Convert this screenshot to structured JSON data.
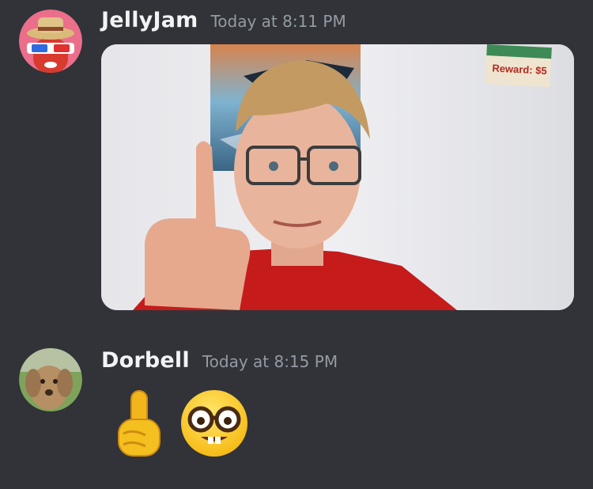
{
  "messages": [
    {
      "username": "JellyJam",
      "timestamp": "Today at 8:11 PM",
      "avatar_icon": "hat-3d-glasses-avatar",
      "attachment": {
        "type": "image",
        "icon": "photo-thumbnail",
        "poster_text": "Reward: $5"
      }
    },
    {
      "username": "Dorbell",
      "timestamp": "Today at 8:15 PM",
      "avatar_icon": "dog-avatar",
      "emojis": [
        "pointing-up-emoji",
        "nerd-face-emoji"
      ]
    }
  ],
  "colors": {
    "background": "#313338",
    "username": "#f2f3f5",
    "timestamp": "#949ba4",
    "shirt": "#c61b1b"
  }
}
